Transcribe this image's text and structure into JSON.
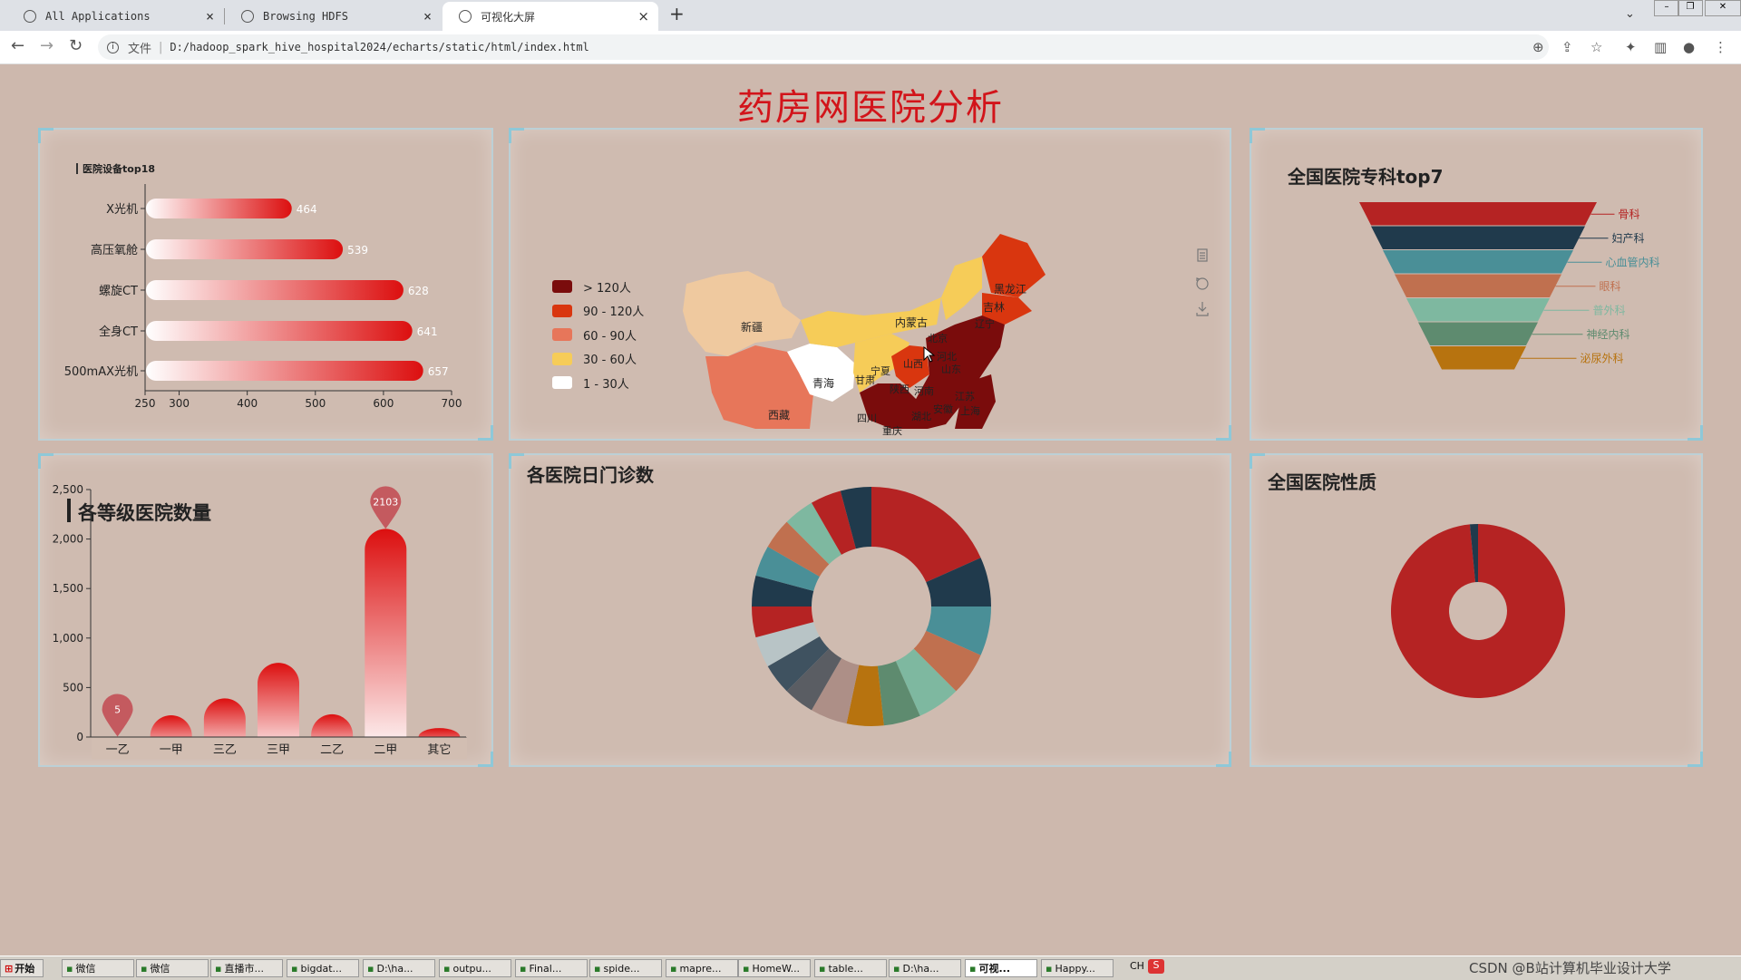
{
  "browser": {
    "tabs": [
      {
        "label": "All Applications"
      },
      {
        "label": "Browsing HDFS"
      },
      {
        "label": "可视化大屏"
      }
    ],
    "new_tab_symbol": "+",
    "security_label": "文件",
    "url": "D:/hadoop_spark_hive_hospital2024/echarts/static/html/index.html"
  },
  "page": {
    "title": "药房网医院分析"
  },
  "panels": {
    "equipment": {
      "title": "医院设备top18"
    },
    "map": {
      "legend": [
        "> 120人",
        "90 - 120人",
        "60 - 90人",
        "30 - 60人",
        "1 - 30人"
      ],
      "legend_colors": [
        "#7a0c0c",
        "#d9360f",
        "#e7765a",
        "#f6cc58",
        "#ffffff"
      ],
      "province_labels": [
        "新疆",
        "西藏",
        "青海",
        "甘肃",
        "宁夏",
        "内蒙古",
        "黑龙江",
        "吉林",
        "辽宁",
        "北京",
        "河北",
        "山西",
        "陕西",
        "河南",
        "山东",
        "江苏",
        "上海",
        "四川",
        "湖北",
        "安徽",
        "重庆"
      ],
      "tool_icons": [
        "data-view-icon",
        "restore-icon",
        "save-image-icon"
      ]
    },
    "specialty": {
      "title": "全国医院专科top7"
    },
    "grade": {
      "title": "各等级医院数量"
    },
    "outpatient": {
      "title": "各医院日门诊数"
    },
    "nature": {
      "title": "全国医院性质"
    }
  },
  "chart_data": [
    {
      "id": "equipment",
      "type": "bar",
      "orientation": "horizontal",
      "title": "医院设备top18",
      "categories": [
        "500mAX光机",
        "全身CT",
        "螺旋CT",
        "高压氧舱",
        "X光机"
      ],
      "values": [
        657,
        641,
        628,
        539,
        464
      ],
      "xlim": [
        250,
        700
      ],
      "xticks": [
        "250",
        "300",
        "400",
        "500",
        "600",
        "700"
      ]
    },
    {
      "id": "specialty",
      "type": "funnel",
      "title": "全国医院专科top7",
      "categories": [
        "骨科",
        "妇产科",
        "心血管内科",
        "眼科",
        "普外科",
        "神经内科",
        "泌尿外科"
      ],
      "colors": [
        "#b52323",
        "#203a4c",
        "#4a8f97",
        "#c0704f",
        "#7eb8a0",
        "#5e8b6f",
        "#b7730f"
      ]
    },
    {
      "id": "grade",
      "type": "bar",
      "title": "各等级医院数量",
      "categories": [
        "一乙",
        "一甲",
        "三乙",
        "三甲",
        "二乙",
        "二甲",
        "其它"
      ],
      "values": [
        5,
        220,
        390,
        750,
        230,
        2103,
        90
      ],
      "ylim": [
        0,
        2500
      ],
      "yticks": [
        "0",
        "500",
        "1,000",
        "1,500",
        "2,000",
        "2,500"
      ],
      "marked_points": [
        {
          "category": "一乙",
          "label": "5"
        },
        {
          "category": "二甲",
          "label": "2103"
        }
      ]
    },
    {
      "id": "outpatient",
      "type": "pie",
      "title": "各医院日门诊数",
      "inner_radius_ratio": 0.5,
      "values": [
        22,
        8,
        8,
        7,
        7,
        6,
        6,
        6,
        5,
        5,
        5,
        5,
        5,
        5,
        5,
        5,
        5,
        5
      ],
      "colors": [
        "#b52323",
        "#203a4c",
        "#4a8f97",
        "#c0704f",
        "#7eb8a0",
        "#5e8b6f",
        "#b7730f",
        "#ad8f87",
        "#5a5d63",
        "#3f5260",
        "#b8c4c6",
        "#b52323",
        "#203a4c",
        "#4a8f97",
        "#c0704f",
        "#7eb8a0",
        "#b52323",
        "#203a4c"
      ]
    },
    {
      "id": "nature",
      "type": "pie",
      "title": "全国医院性质",
      "inner_radius_ratio": 0.33,
      "values": [
        98.5,
        1.5
      ],
      "colors": [
        "#b52323",
        "#203a4c"
      ]
    }
  ],
  "taskbar": {
    "start": "开始",
    "items": [
      "微信",
      "微信",
      "直播市...",
      "bigdat...",
      "D:\\ha...",
      "outpu...",
      "Final...",
      "spide...",
      "mapre...",
      "HomeW...",
      "table...",
      "D:\\ha...",
      "可视...",
      "Happy..."
    ],
    "ime": "CH",
    "watermark": "CSDN @B站计算机毕业设计大学"
  }
}
